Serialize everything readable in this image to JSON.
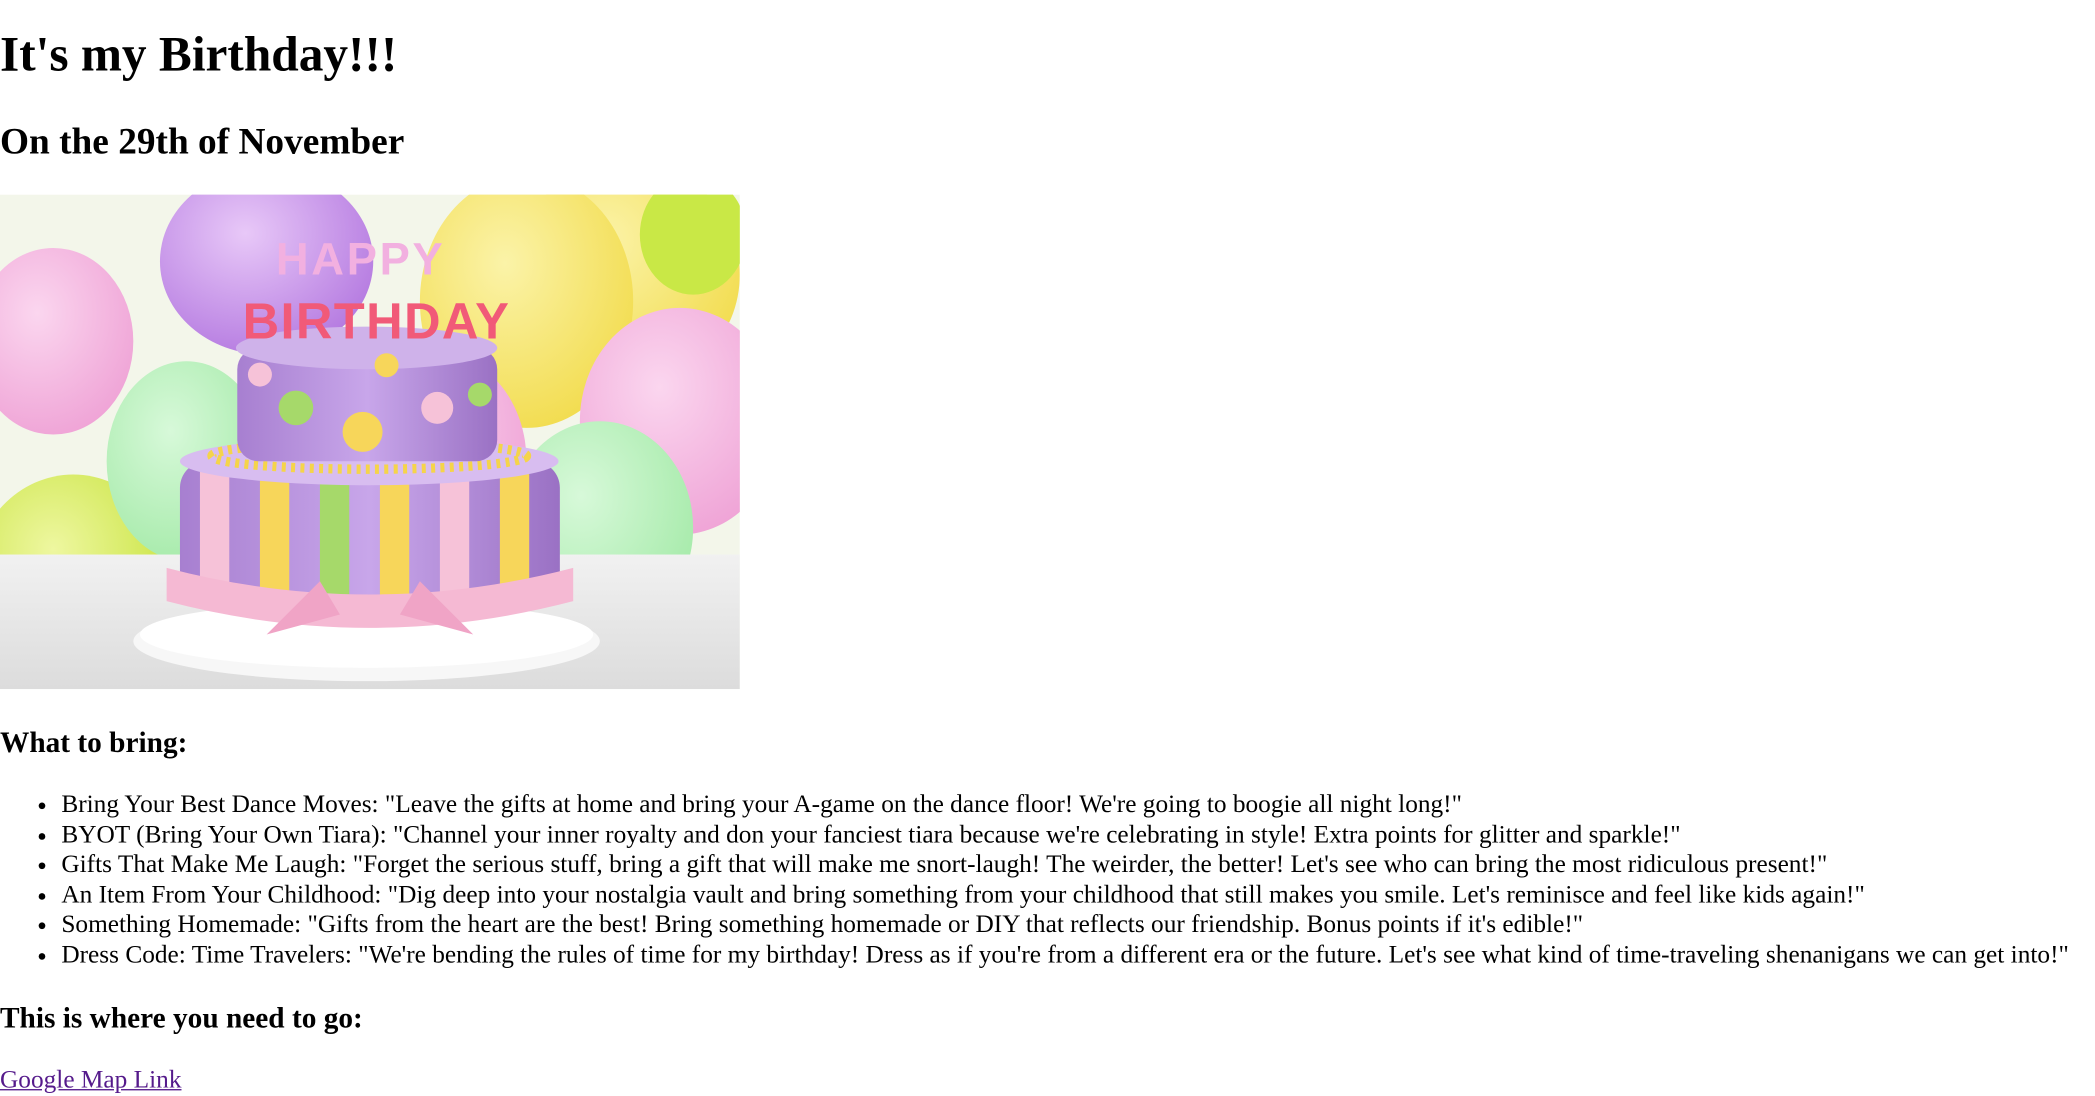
{
  "heading": "It's my Birthday!!!",
  "subheading": "On the 29th of November",
  "image": {
    "candle_letters_top": "HAPPY",
    "candle_letters_bottom": "BIRTHDAY"
  },
  "bring_section": {
    "title": "What to bring:",
    "items": [
      "Bring Your Best Dance Moves: \"Leave the gifts at home and bring your A-game on the dance floor! We're going to boogie all night long!\"",
      "BYOT (Bring Your Own Tiara): \"Channel your inner royalty and don your fanciest tiara because we're celebrating in style! Extra points for glitter and sparkle!\"",
      "Gifts That Make Me Laugh: \"Forget the serious stuff, bring a gift that will make me snort-laugh! The weirder, the better! Let's see who can bring the most ridiculous present!\"",
      "An Item From Your Childhood: \"Dig deep into your nostalgia vault and bring something from your childhood that still makes you smile. Let's reminisce and feel like kids again!\"",
      "Something Homemade: \"Gifts from the heart are the best! Bring something homemade or DIY that reflects our friendship. Bonus points if it's edible!\"",
      "Dress Code: Time Travelers: \"We're bending the rules of time for my birthday! Dress as if you're from a different era or the future. Let's see what kind of time-traveling shenanigans we can get into!\""
    ]
  },
  "location_section": {
    "title": "This is where you need to go:",
    "link_label": "Google Map Link"
  },
  "colors": {
    "link_visited": "#551a8b",
    "text": "#000000",
    "background": "#ffffff"
  }
}
